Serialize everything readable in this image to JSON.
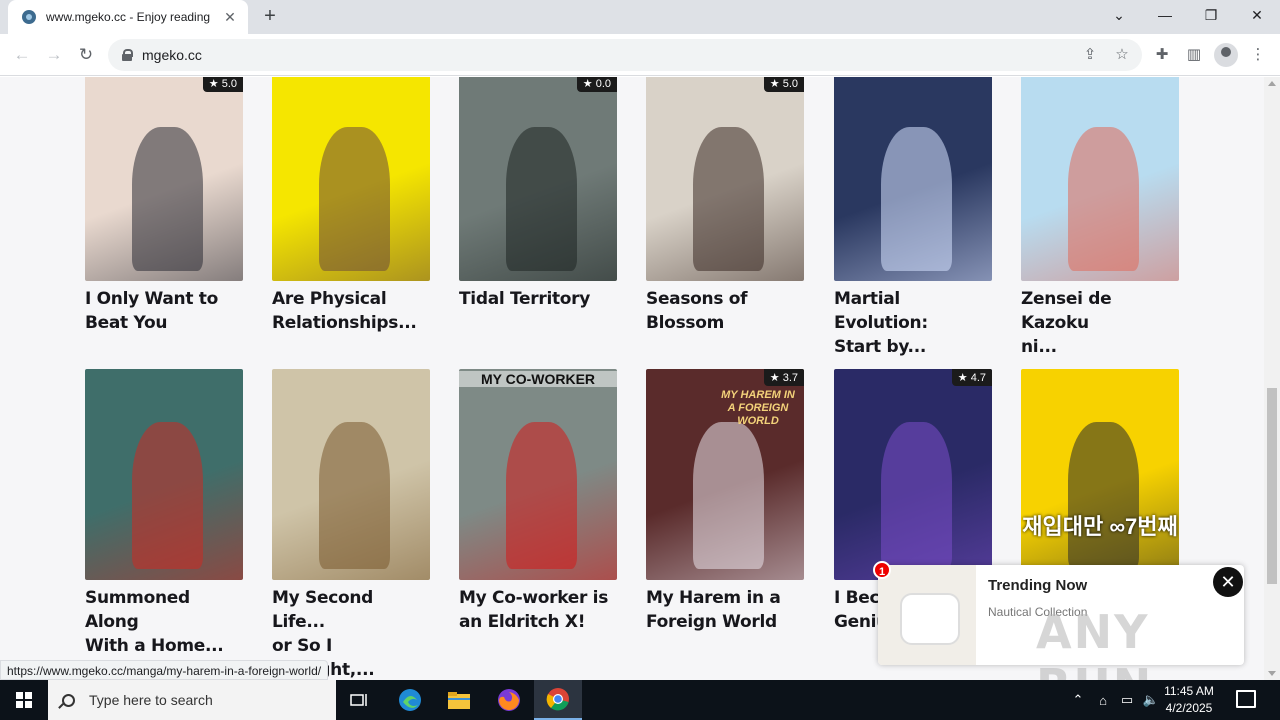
{
  "browser": {
    "tab_title": "www.mgeko.cc - Enjoy reading",
    "tab_close": "✕",
    "new_tab": "+",
    "url": "mgeko.cc",
    "window_controls": {
      "collapse": "⌄",
      "minimize": "—",
      "restore": "❐",
      "close": "✕"
    }
  },
  "grid": {
    "row1": [
      {
        "title_lines": [
          "I Only Want to",
          "Beat You"
        ],
        "rating": "5.0",
        "cover_bg": "#e9d9cf",
        "accent": "#2c2c34"
      },
      {
        "title_lines": [
          "Are Physical",
          "Relationships..."
        ],
        "rating": "",
        "cover_bg": "#f5e600",
        "accent": "#6b4a3a"
      },
      {
        "title_lines": [
          "Tidal Territory"
        ],
        "rating": "0.0",
        "cover_bg": "#6f7a77",
        "accent": "#1d2422"
      },
      {
        "title_lines": [
          "Seasons of",
          "Blossom"
        ],
        "rating": "5.0",
        "cover_bg": "#d9d2c8",
        "accent": "#3b2a24"
      },
      {
        "title_lines": [
          "Martial Evolution:",
          "Start by..."
        ],
        "rating": "",
        "cover_bg": "#2a3860",
        "accent": "#d6e1ff"
      },
      {
        "title_lines": [
          "Zensei de Kazoku",
          "ni..."
        ],
        "rating": "",
        "cover_bg": "#b8dcf0",
        "accent": "#e06a5a"
      }
    ],
    "row2": [
      {
        "title_lines": [
          "Summoned Along",
          "With a Home..."
        ],
        "rating": "",
        "cover_bg": "#3f6e6a",
        "accent": "#cc2a22"
      },
      {
        "title_lines": [
          "My Second Life...",
          "or So I Thought,..."
        ],
        "rating": "",
        "cover_bg": "#cfc4a8",
        "accent": "#7a5a2e"
      },
      {
        "title_lines": [
          "My Co-worker is",
          "an Eldritch X!"
        ],
        "rating": "",
        "cover_bg": "#7e8a86",
        "accent": "#d41a1a"
      },
      {
        "title_lines": [
          "My Harem in a",
          "Foreign World"
        ],
        "rating": "3.7",
        "cover_bg": "#5a2b2b",
        "accent": "#e9e2ea"
      },
      {
        "title_lines": [
          "I Beca",
          "Geniu"
        ],
        "rating": "4.7",
        "cover_bg": "#2a2a66",
        "accent": "#7a4cc8"
      },
      {
        "title_lines": [
          "",
          ""
        ],
        "rating": "",
        "cover_bg": "#f7d200",
        "accent": "#2a2a2a"
      }
    ],
    "cover_texts": {
      "co_worker_banner": "MY CO-WORKER",
      "harem_banner": "MY HAREM IN A FOREIGN WORLD",
      "last_cover_text": "재입대만 ∞7번째"
    }
  },
  "status_url": "https://www.mgeko.cc/manga/my-harem-in-a-foreign-world/",
  "popup": {
    "badge": "1",
    "title": "Trending Now",
    "subtitle": "Nautical Collection",
    "close": "✕"
  },
  "watermark": "ANY RUN",
  "taskbar": {
    "search_placeholder": "Type here to search",
    "time": "11:45 AM",
    "date": "4/2/2025"
  },
  "colors": {
    "page_bg": "#f6f6f8",
    "taskbar": "#0c1219"
  }
}
